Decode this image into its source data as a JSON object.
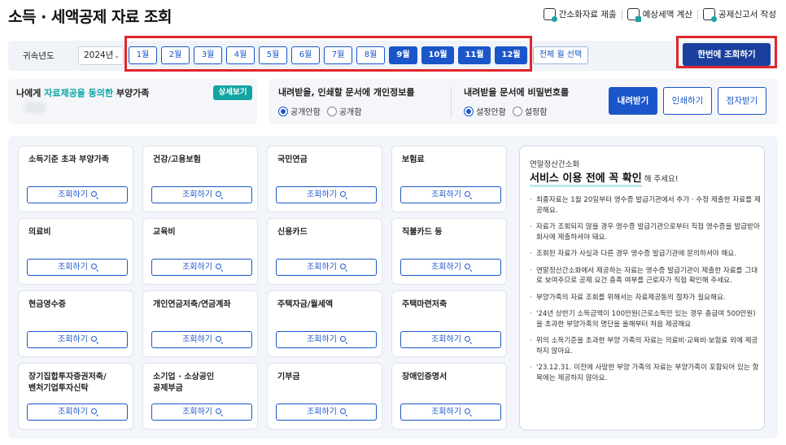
{
  "header": {
    "title": "소득 · 세액공제 자료 조회",
    "links": [
      {
        "label": "간소화자료 제출",
        "icon": "document-submit-icon"
      },
      {
        "label": "예상세액 계산",
        "icon": "calculator-icon"
      },
      {
        "label": "공제신고서 작성",
        "icon": "document-edit-icon"
      }
    ]
  },
  "year_bar": {
    "label": "귀속년도",
    "year": "2024년",
    "months": [
      "1월",
      "2월",
      "3월",
      "4월",
      "5월",
      "6월",
      "7월",
      "8월",
      "9월",
      "10월",
      "11월",
      "12월"
    ],
    "selected_months": [
      "9월",
      "10월",
      "11월",
      "12월"
    ],
    "all_months_label": "전체 월 선택",
    "query_all_label": "한번에 조회하기"
  },
  "consent": {
    "prefix": "나에게 ",
    "highlight": "자료제공을 동의한",
    "suffix": " 부양가족",
    "detail_label": "상세보기"
  },
  "options": {
    "personal_info": {
      "title": "내려받을, 인쇄할 문서에 개인정보를",
      "choices": [
        "공개안함",
        "공개함"
      ],
      "selected": "공개안함"
    },
    "password": {
      "title": "내려받을 문서에 비밀번호를",
      "choices": [
        "설정안함",
        "설정함"
      ],
      "selected": "설정안함"
    },
    "actions": [
      "내려받기",
      "인쇄하기",
      "점자받기"
    ]
  },
  "cards": [
    {
      "title": "소득기준 초과 부양가족",
      "button": "조회하기"
    },
    {
      "title": "건강/고용보험",
      "button": "조회하기"
    },
    {
      "title": "국민연금",
      "button": "조회하기"
    },
    {
      "title": "보험료",
      "button": "조회하기"
    },
    {
      "title": "의료비",
      "button": "조회하기"
    },
    {
      "title": "교육비",
      "button": "조회하기"
    },
    {
      "title": "신용카드",
      "button": "조회하기"
    },
    {
      "title": "직불카드 등",
      "button": "조회하기"
    },
    {
      "title": "현금영수증",
      "button": "조회하기"
    },
    {
      "title": "개인연금저축/연금계좌",
      "button": "조회하기"
    },
    {
      "title": "주택자금/월세액",
      "button": "조회하기"
    },
    {
      "title": "주택마련저축",
      "button": "조회하기"
    },
    {
      "title": "장기집합투자증권저축/\n벤처기업투자신탁",
      "button": "조회하기"
    },
    {
      "title": "소기업 · 소상공인\n공제부금",
      "button": "조회하기"
    },
    {
      "title": "기부금",
      "button": "조회하기"
    },
    {
      "title": "장애인증명서",
      "button": "조회하기"
    }
  ],
  "notice": {
    "subtitle": "연말정산간소화",
    "heading": "서비스 이용 전에 꼭 확인",
    "heading_tail": " 해 주세요!",
    "items": [
      "최종자료는 1월 20일부터 영수증 발급기관에서 추가 · 수정 제출한 자료를 제공해요.",
      "자료가 조회되지 않을 경우 영수증 발급기관으로부터 직접 영수증을 발급받아 회사에 제출하셔야 돼요.",
      "조회된 자료가 사실과 다른 경우 영수증 발급기관에 문의하셔야 해요.",
      "연말정산간소화에서 제공하는 자료는 영수증 발급기관이 제출한 자료를 그대로 보여주므로 공제 요건 충족 여부를 근로자가 직접 확인해 주세요.",
      "부양가족의 자료 조회를 위해서는 자료제공동의 절차가 필요해요.",
      "'24년 상반기 소득금액이 100만원(근로소득만 있는 경우 총급여 500만원)을 초과한 부양가족의 명단을 올해부터 처음 제공해요",
      "위의 소득기준을 초과한 부양 가족의 자료는 의료비·교육비·보험료 외에 제공하지 않아요.",
      "'23.12.31. 이전에 사망한 부양 가족의 자료는 부양가족이 포함되어 있는 항목에는 제공하지 않아요."
    ]
  },
  "colors": {
    "primary": "#1a56c9",
    "dark_primary": "#1a3f9c",
    "teal": "#14a3a3",
    "highlight_red": "#e0262c"
  }
}
